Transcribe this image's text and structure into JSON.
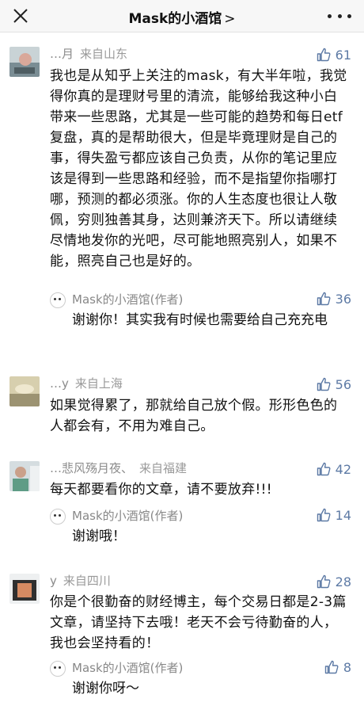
{
  "header": {
    "title": "Mask的小酒馆",
    "chevron": ">",
    "close_icon": "close-icon",
    "more_icon": "more-dots-icon"
  },
  "comments": [
    {
      "name": "…月",
      "location": "来自山东",
      "likes": "61",
      "text": "我也是从知乎上关注的mask，有大半年啦，我觉得你真的是理财号里的清流，能够给我这种小白带来一些思路，尤其是一些可能的趋势和每日etf复盘，真的是帮助很大，但是毕竟理财是自己的事，得失盈亏都应该自己负责，从你的笔记里应该是得到一些思路和经验，而不是指望你指哪打哪，预测的都必须涨。你的人生态度也很让人敬佩，穷则独善其身，达则兼济天下。所以请继续尽情地发你的光吧，尽可能地照亮别人，如果不能，照亮自己也是好的。",
      "reply": {
        "name": "Mask的小酒馆(作者)",
        "likes": "36",
        "text": "谢谢你！其实我有时候也需要给自己充充电"
      }
    },
    {
      "name": "…y",
      "location": "来自上海",
      "likes": "56",
      "text": "如果觉得累了，那就给自己放个假。形形色色的人都会有，不用为难自己。"
    },
    {
      "name": "…悲风殇月夜、",
      "location": "来自福建",
      "likes": "42",
      "text": "每天都要看你的文章，请不要放弃!!!",
      "reply": {
        "name": "Mask的小酒馆(作者)",
        "likes": "14",
        "text": "谢谢哦！"
      }
    },
    {
      "name": "y",
      "location": "来自四川",
      "likes": "28",
      "text": "你是个很勤奋的财经博主，每个交易日都是2-3篇文章，请坚持下去哦！老天不会亏待勤奋的人，我也会坚持看的！",
      "reply": {
        "name": "Mask的小酒馆(作者)",
        "likes": "8",
        "text": "谢谢你呀～"
      }
    }
  ],
  "colors": {
    "like_blue": "#5d7aa5",
    "meta_gray": "#999999",
    "topbar_bg": "#f7f7f7"
  }
}
